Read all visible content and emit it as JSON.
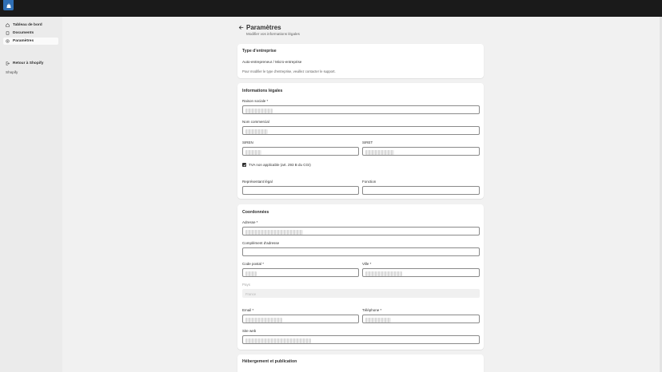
{
  "sidebar": {
    "items": [
      {
        "label": "Tableau de bord",
        "icon": "home-icon"
      },
      {
        "label": "Documents",
        "icon": "document-icon"
      },
      {
        "label": "Paramètres",
        "icon": "gear-icon",
        "active": true
      }
    ],
    "section_label": "Shopify",
    "back_link": {
      "label": "Retour à Shopify",
      "icon": "exit-icon"
    }
  },
  "header": {
    "title": "Paramètres",
    "subtitle": "Modifier vos informations légales"
  },
  "company_type": {
    "title": "Type d'entreprise",
    "value": "Auto-entrepreneur / Micro-entreprise",
    "note": "Pour modifier le type d'entreprise, veuillez contacter le support."
  },
  "legal": {
    "title": "Informations légales",
    "raison_sociale_label": "Raison sociale *",
    "nom_commercial_label": "Nom commercial",
    "siren_label": "SIREN",
    "siret_label": "SIRET",
    "tva_label": "TVA non applicable (art. 293 B du CGI)",
    "tva_checked": true,
    "representant_label": "Représentant légal",
    "fonction_label": "Fonction"
  },
  "coordinates": {
    "title": "Coordonnées",
    "adresse_label": "Adresse *",
    "complement_label": "Complément d'adresse",
    "code_postal_label": "Code postal *",
    "ville_label": "Ville *",
    "pays_label": "Pays",
    "pays_value": "France",
    "email_label": "Email *",
    "telephone_label": "Téléphone *",
    "site_label": "Site web"
  },
  "hosting": {
    "title": "Hébergement et publication"
  },
  "colors": {
    "topbar": "#1a1a1a",
    "sidebar_bg": "#ebebeb",
    "page_bg": "#f1f1f1",
    "logo": "#2f6fb5"
  }
}
